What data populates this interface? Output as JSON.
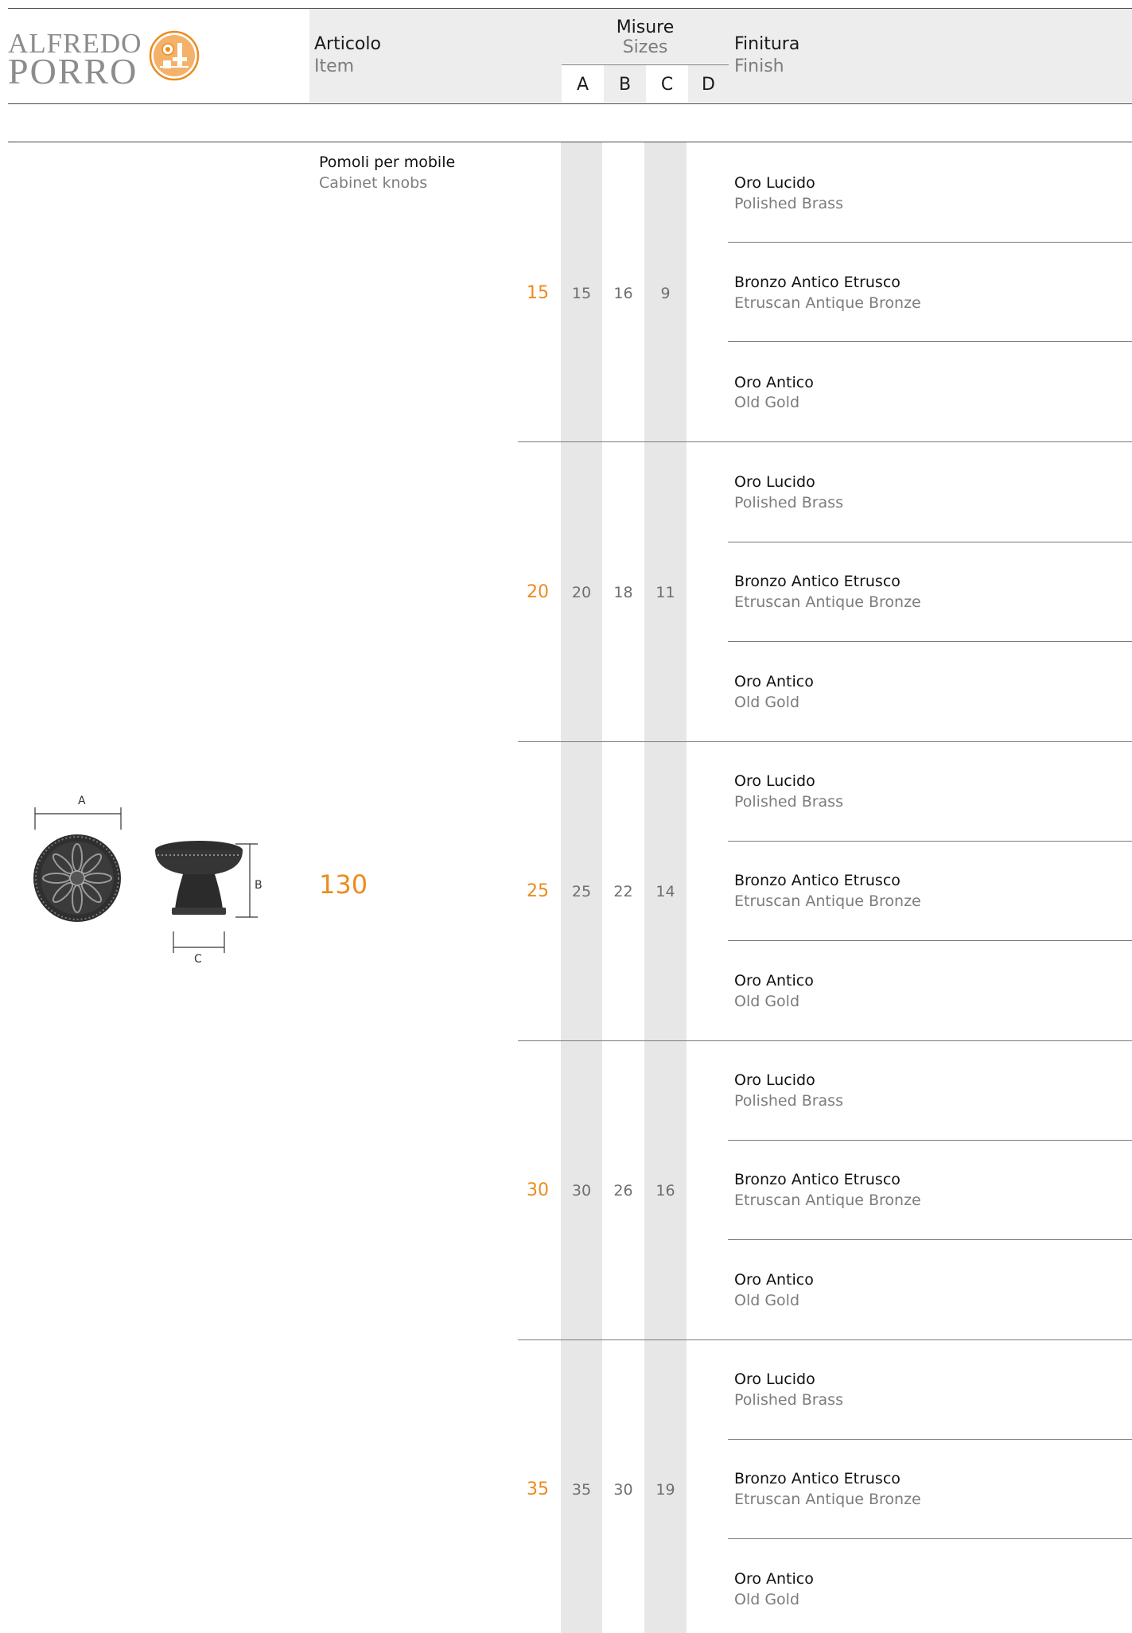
{
  "brand": {
    "line1": "ALFREDO",
    "line2": "PORRO"
  },
  "header": {
    "item_it": "Articolo",
    "item_en": "Item",
    "sizes_it": "Misure",
    "sizes_en": "Sizes",
    "cols": [
      "A",
      "B",
      "C",
      "D"
    ],
    "finish_it": "Finitura",
    "finish_en": "Finish"
  },
  "product": {
    "name_it": "Pomoli per mobile",
    "name_en": "Cabinet knobs",
    "code": "130",
    "dims": [
      "A",
      "B",
      "C"
    ]
  },
  "finishes": [
    {
      "it": "Oro Lucido",
      "en": "Polished Brass"
    },
    {
      "it": "Bronzo Antico Etrusco",
      "en": "Etruscan Antique Bronze"
    },
    {
      "it": "Oro Antico",
      "en": "Old Gold"
    }
  ],
  "variants": [
    {
      "code": "15",
      "a": "15",
      "b": "16",
      "c": "9",
      "d": ""
    },
    {
      "code": "20",
      "a": "20",
      "b": "18",
      "c": "11",
      "d": ""
    },
    {
      "code": "25",
      "a": "25",
      "b": "22",
      "c": "14",
      "d": ""
    },
    {
      "code": "30",
      "a": "30",
      "b": "26",
      "c": "16",
      "d": ""
    },
    {
      "code": "35",
      "a": "35",
      "b": "30",
      "c": "19",
      "d": ""
    }
  ],
  "colors": {
    "accent": "#ec8b1e",
    "header_bg": "#ededed",
    "band": "#e7e7e7"
  }
}
